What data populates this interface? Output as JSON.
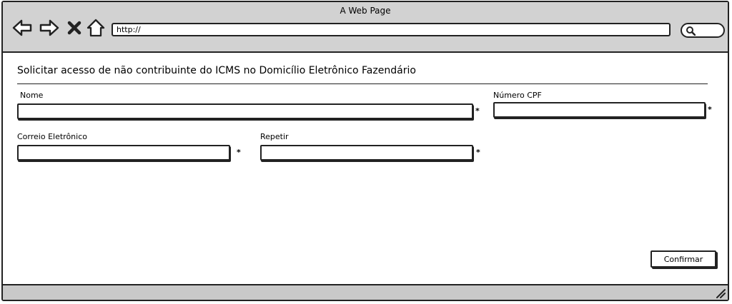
{
  "browser": {
    "window_title": "A Web Page",
    "url": "http://",
    "icons": {
      "back": "back-arrow-icon",
      "forward": "forward-arrow-icon",
      "stop": "close-icon",
      "home": "home-icon",
      "search": "search-icon",
      "resize": "resize-grip-icon"
    }
  },
  "form": {
    "heading": "Solicitar acesso de não contribuinte do ICMS no Domicílio Eletrônico Fazendário",
    "required_marker": "*",
    "fields": {
      "nome": {
        "label": "Nome",
        "value": ""
      },
      "cpf": {
        "label": "Número CPF",
        "value": ""
      },
      "email": {
        "label": "Correio Eletrônico",
        "value": ""
      },
      "repetir": {
        "label": "Repetir",
        "value": ""
      }
    },
    "confirm_label": "Confirmar"
  }
}
